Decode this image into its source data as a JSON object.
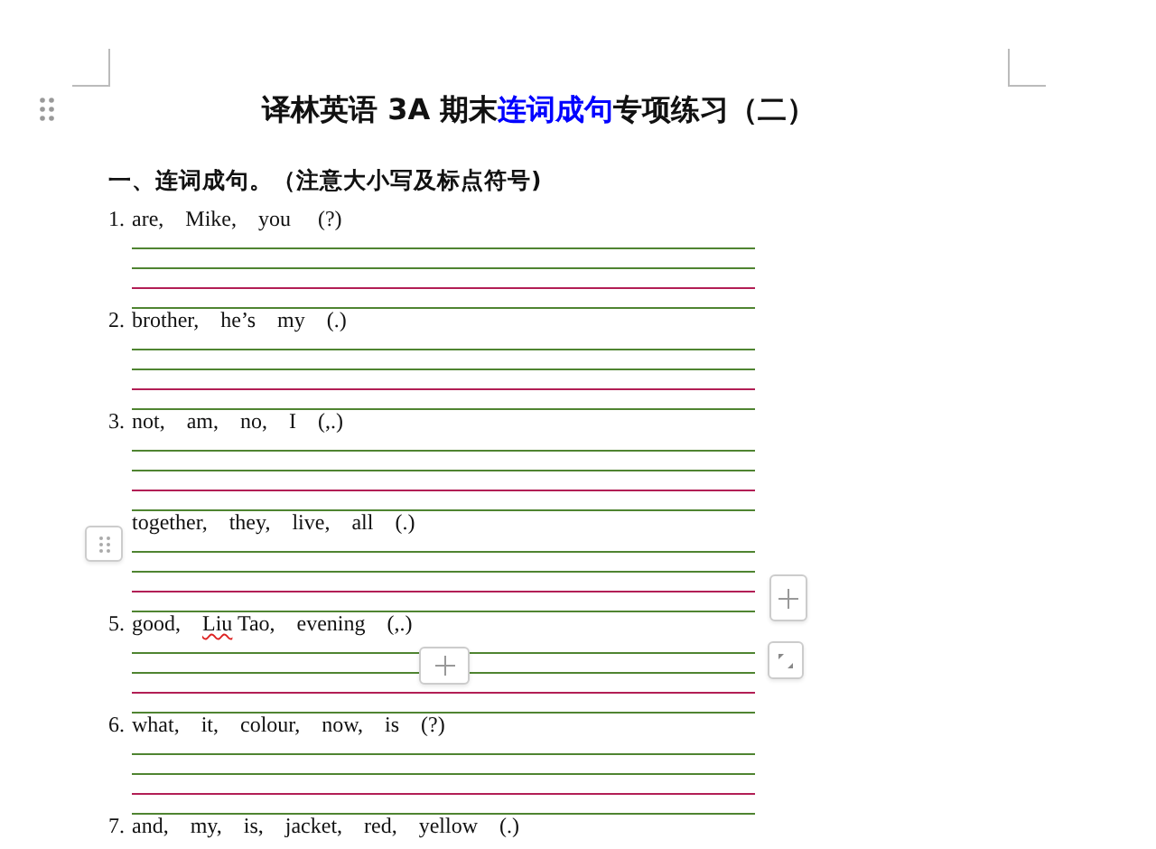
{
  "title": [
    {
      "text": "译林英语 3A 期末",
      "highlighted": false
    },
    {
      "text": "连词成句",
      "highlighted": true
    },
    {
      "text": "专项练习（二）",
      "highlighted": false
    }
  ],
  "section_heading": "一、连词成句。（注意大小写及标点符号)",
  "questions": [
    {
      "number": "1.",
      "segments": [
        {
          "text": "are,    Mike,    you     (?)",
          "misspelled": false
        }
      ]
    },
    {
      "number": "2.",
      "segments": [
        {
          "text": "brother,    he’s    my    (.)",
          "misspelled": false
        }
      ]
    },
    {
      "number": "3.",
      "segments": [
        {
          "text": "not,    am,    no,    I    (,.)",
          "misspelled": false
        }
      ]
    },
    {
      "segments": [
        {
          "text": "together,    they,    live,    all    (.)",
          "misspelled": false
        }
      ]
    },
    {
      "number": "5.",
      "segments": [
        {
          "text": "good,    ",
          "misspelled": false
        },
        {
          "text": "Liu",
          "misspelled": true
        },
        {
          "text": " Tao,    evening    (,.)",
          "misspelled": false
        }
      ]
    },
    {
      "number": "6.",
      "segments": [
        {
          "text": "what,    it,    colour,    now,    is    (?)",
          "misspelled": false
        }
      ]
    },
    {
      "number": "7.",
      "segments": [
        {
          "text": "and,    my,    is,    jacket,    red,    yellow    (.)",
          "misspelled": false
        }
      ]
    }
  ]
}
